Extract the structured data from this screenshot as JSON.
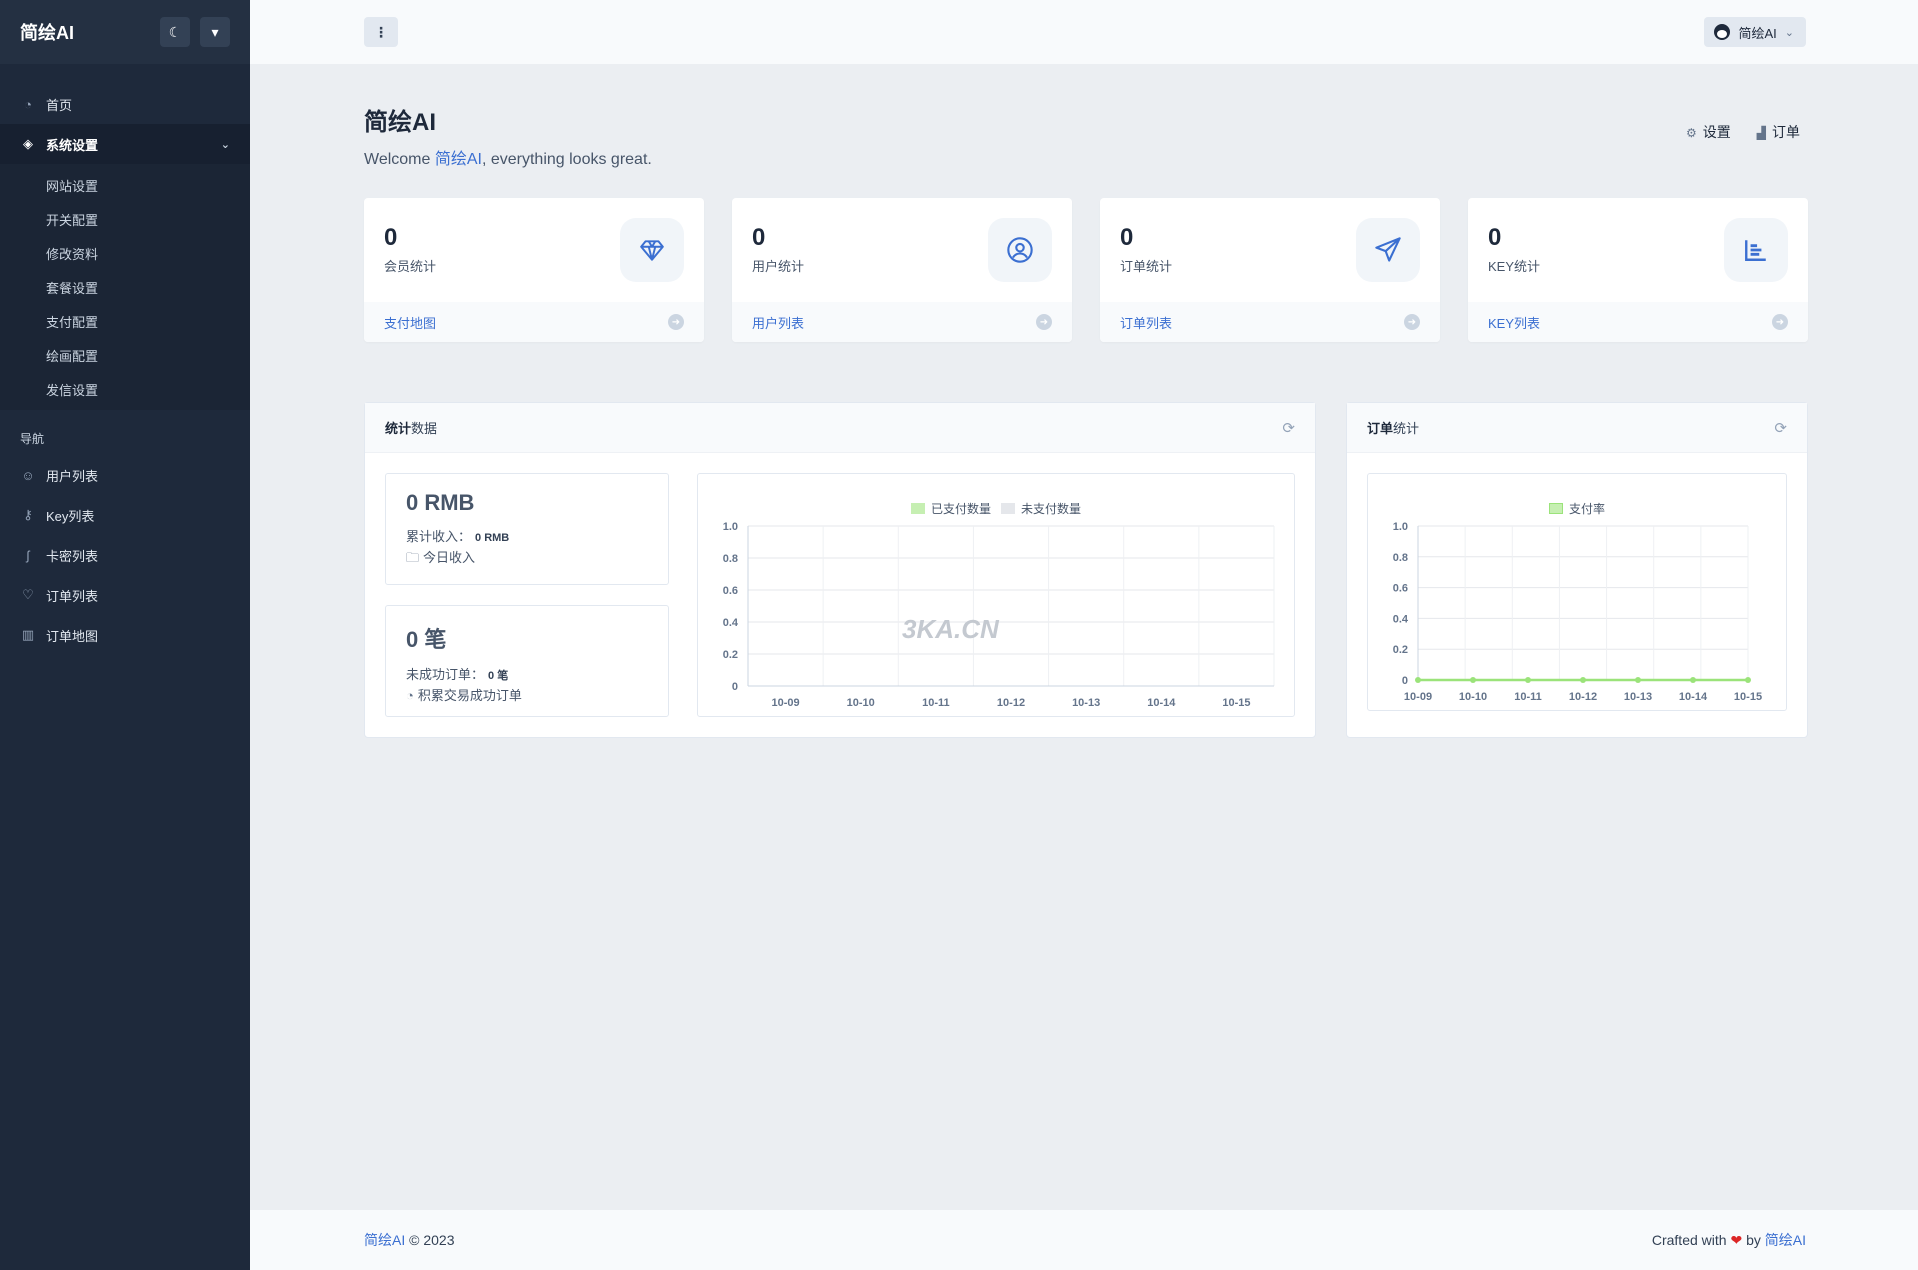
{
  "brand": "简绘AI",
  "sidebar": {
    "items_top": [
      {
        "label": "首页",
        "icon": "dashboard-icon"
      }
    ],
    "system": {
      "label": "系统设置",
      "sub": [
        "网站设置",
        "开关配置",
        "修改资料",
        "套餐设置",
        "支付配置",
        "绘画配置",
        "发信设置"
      ]
    },
    "section_title": "导航",
    "nav": [
      {
        "label": "用户列表",
        "icon": "user-icon"
      },
      {
        "label": "Key列表",
        "icon": "key-icon"
      },
      {
        "label": "卡密列表",
        "icon": "card-icon"
      },
      {
        "label": "订单列表",
        "icon": "heart-icon"
      },
      {
        "label": "订单地图",
        "icon": "map-icon"
      }
    ]
  },
  "topbar": {
    "menu_glyph": "⋮",
    "user_name": "简绘AI"
  },
  "page": {
    "title": "简绘AI",
    "welcome_prefix": "Welcome ",
    "welcome_name": "简绘AI",
    "welcome_suffix": ", everything looks great.",
    "link_settings": "设置",
    "link_orders": "订单"
  },
  "stats": [
    {
      "value": "0",
      "label": "会员统计",
      "link": "支付地图",
      "icon": "diamond-icon"
    },
    {
      "value": "0",
      "label": "用户统计",
      "link": "用户列表",
      "icon": "user-circle-icon"
    },
    {
      "value": "0",
      "label": "订单统计",
      "link": "订单列表",
      "icon": "paper-plane-icon"
    },
    {
      "value": "0",
      "label": "KEY统计",
      "link": "KEY列表",
      "icon": "bar-chart-icon"
    }
  ],
  "stats_panel": {
    "title_bold": "统计",
    "title_rest": "数据",
    "revenue": {
      "value": "0 RMB",
      "total_label": "累计收入：",
      "total_value": "0 RMB",
      "today_label": "今日收入"
    },
    "orders": {
      "value": "0 笔",
      "failed_label": "未成功订单：",
      "failed_value": "0 笔",
      "success_label": "积累交易成功订单"
    },
    "watermark": "3KA.CN"
  },
  "order_panel": {
    "title_bold": "订单",
    "title_rest": "统计"
  },
  "colors": {
    "accent": "#3b6fd1",
    "sidebar": "#1e293b",
    "paid": "#c6efb2",
    "unpaid": "#e5e7eb",
    "rate_line": "#9be37a"
  },
  "chart_data": [
    {
      "type": "bar",
      "categories": [
        "10-09",
        "10-10",
        "10-11",
        "10-12",
        "10-13",
        "10-14",
        "10-15"
      ],
      "series": [
        {
          "name": "已支付数量",
          "values": [
            0,
            0,
            0,
            0,
            0,
            0,
            0
          ]
        },
        {
          "name": "未支付数量",
          "values": [
            0,
            0,
            0,
            0,
            0,
            0,
            0
          ]
        }
      ],
      "yticks": [
        "0",
        "0.2",
        "0.4",
        "0.6",
        "0.8",
        "1.0"
      ],
      "ylim": [
        0,
        1
      ],
      "legend": "top-center",
      "grid": true
    },
    {
      "type": "line",
      "categories": [
        "10-09",
        "10-10",
        "10-11",
        "10-12",
        "10-13",
        "10-14",
        "10-15"
      ],
      "series": [
        {
          "name": "支付率",
          "values": [
            0,
            0,
            0,
            0,
            0,
            0,
            0
          ]
        }
      ],
      "yticks": [
        "0",
        "0.2",
        "0.4",
        "0.6",
        "0.8",
        "1.0"
      ],
      "ylim": [
        0,
        1
      ],
      "legend": "top-center",
      "grid": true
    }
  ],
  "footer": {
    "brand": "简绘AI",
    "year": "© 2023",
    "crafted": "Crafted with",
    "by": "by",
    "author": "简绘AI"
  }
}
